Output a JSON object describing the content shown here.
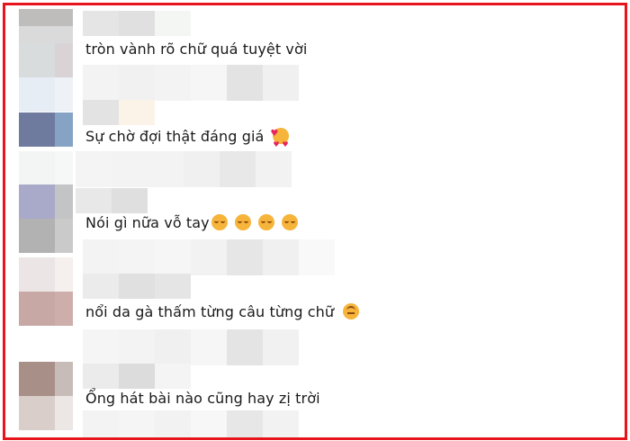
{
  "comments": [
    {
      "text": "tròn vành rõ chữ quá tuyệt vời",
      "emojis": []
    },
    {
      "text": "Sự chờ đợi thật đáng giá",
      "emojis": [
        "smiling-face-with-hearts-icon"
      ]
    },
    {
      "text": "Nói gì nữa vỗ tay",
      "emojis": [
        "relieved-face-icon",
        "relieved-face-icon",
        "relieved-face-icon",
        "relieved-face-icon"
      ]
    },
    {
      "text": "nổi da gà thấm từng câu từng chữ",
      "emojis": [
        "upside-down-face-icon"
      ]
    },
    {
      "text": "Ổng hát bài nào cũng hay zị trời",
      "emojis": []
    }
  ],
  "colors": {
    "border": "#e8141b",
    "text": "#1a1a1a"
  }
}
